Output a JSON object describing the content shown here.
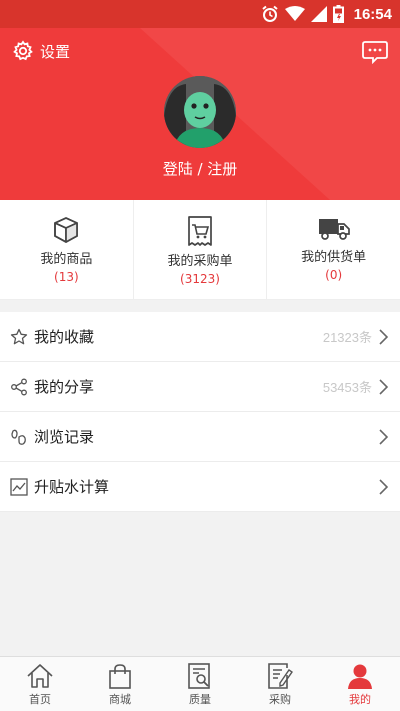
{
  "statusbar": {
    "time": "16:54"
  },
  "header": {
    "settings_label": "设置",
    "login_label": "登陆 / 注册"
  },
  "stats": [
    {
      "label": "我的商品",
      "count": "(13)",
      "icon": "box-icon"
    },
    {
      "label": "我的采购单",
      "count": "(3123)",
      "icon": "receipt-cart-icon"
    },
    {
      "label": "我的供货单",
      "count": "(0)",
      "icon": "truck-icon"
    }
  ],
  "menu": [
    {
      "label": "我的收藏",
      "count": "21323条",
      "icon": "star-icon"
    },
    {
      "label": "我的分享",
      "count": "53453条",
      "icon": "share-icon"
    },
    {
      "label": "浏览记录",
      "count": "",
      "icon": "footprints-icon"
    },
    {
      "label": "升贴水计算",
      "count": "",
      "icon": "chart-icon"
    }
  ],
  "nav": [
    {
      "label": "首页",
      "icon": "home-icon"
    },
    {
      "label": "商城",
      "icon": "bag-icon"
    },
    {
      "label": "质量",
      "icon": "quality-search-icon"
    },
    {
      "label": "采购",
      "icon": "purchase-edit-icon"
    },
    {
      "label": "我的",
      "icon": "user-icon",
      "active": true
    }
  ],
  "colors": {
    "header_red": "#ef3b3b",
    "accent_red": "#e4393c",
    "statusbar_red": "#d8342c"
  }
}
